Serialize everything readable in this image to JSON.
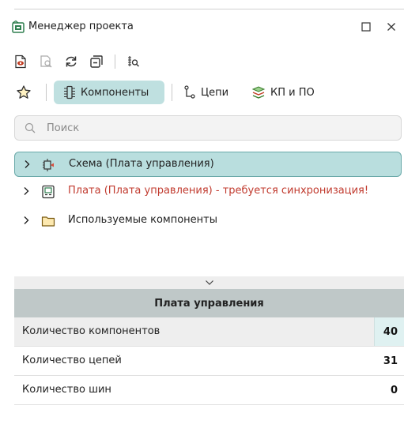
{
  "window": {
    "title": "Менеджер проекта"
  },
  "toolbar": {
    "icons": [
      "show-document-icon",
      "find-in-document-icon",
      "refresh-icon",
      "collapse-all-icon",
      "search-component-icon"
    ]
  },
  "tabs": [
    {
      "label": "",
      "icon": "star-icon",
      "active": false
    },
    {
      "label": "Компоненты",
      "icon": "component-icon",
      "active": true
    },
    {
      "label": "Цепи",
      "icon": "net-icon",
      "active": false
    },
    {
      "label": "КП и ПО",
      "icon": "pads-vias-icon",
      "active": false
    }
  ],
  "search": {
    "placeholder": "Поиск",
    "value": ""
  },
  "tree": [
    {
      "label": "Схема (Плата управления)",
      "icon": "schematic-icon",
      "selected": true,
      "warning": false
    },
    {
      "label": "Плата (Плата управления) - требуется синхронизация!",
      "icon": "board-icon",
      "selected": false,
      "warning": true
    },
    {
      "label": "Используемые компоненты",
      "icon": "folder-icon",
      "selected": false,
      "warning": false
    }
  ],
  "properties": {
    "header": "Плата управления",
    "rows": [
      {
        "name": "Количество компонентов",
        "value": "40"
      },
      {
        "name": "Количество цепей",
        "value": "31"
      },
      {
        "name": "Количество шин",
        "value": "0"
      }
    ]
  },
  "colors": {
    "accent": "#bfe0e0",
    "selected_border": "#6aa9a9",
    "warning_text": "#c13a2e",
    "header_bg": "#bfc8c8"
  }
}
